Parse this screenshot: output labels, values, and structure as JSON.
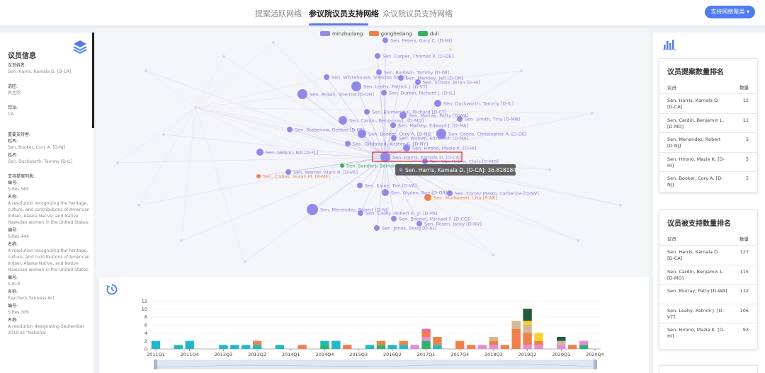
{
  "header": {
    "tabs": [
      {
        "label": "提案活跃网络"
      },
      {
        "label": "参议院议员支持网络"
      },
      {
        "label": "众议院议员支持网络"
      }
    ],
    "action_button": "支持网络聚类"
  },
  "left_panel": {
    "title": "议员信息",
    "name_label": "议员姓名:",
    "name_value": "Sen. Harris, Kamala D. [D-CA]",
    "district_label": "选区:",
    "district_value": "民主党",
    "party_label": "党派:",
    "party_value": "CA",
    "supporters_label": "重要支持者:",
    "supporters": [
      {
        "label": "姓名:",
        "value": "Sen. Booker, Cory A. [D-NJ]"
      },
      {
        "label": "姓名:",
        "value": "Sen. Duckworth, Tammy [D-IL]"
      }
    ],
    "bills_label": "支持提案列表:",
    "bills": [
      {
        "num_label": "编号:",
        "num": "S.Res.565",
        "name_label": "名称:",
        "name": "A resolution recognizing the heritage, culture, and contributions of American Indian, Alaska Native, and Native Hawaiian women in the United States."
      },
      {
        "num_label": "编号:",
        "num": "S.Res.444",
        "name_label": "名称:",
        "name": "A resolution recognizing the heritage, culture, and contributions of American Indian, Alaska Native, and Native Hawaiian women in the United States."
      },
      {
        "num_label": "编号:",
        "num": "S.819",
        "name_label": "名称:",
        "name": "Paycheck Fairness Act"
      },
      {
        "num_label": "编号:",
        "num": "S.Res.309",
        "name_label": "名称:",
        "name": "A resolution designating September 2019 as \"National"
      }
    ]
  },
  "network": {
    "legend": [
      {
        "label": "minzhudang",
        "color": "#8f8ae8"
      },
      {
        "label": "gonghedang",
        "color": "#f0804a"
      },
      {
        "label": "duli",
        "color": "#2fb36a"
      }
    ],
    "nodes": [
      {
        "label": "Sen. Peters, Gary C. [D-MI]",
        "party": "minzhudang"
      },
      {
        "label": "Sen. Carper, Thomas R. [D-DE]",
        "party": "minzhudang"
      },
      {
        "label": "Sen. Baldwin, Tammy [D-WI]",
        "party": "minzhudang"
      },
      {
        "label": "Sen. Whitehouse, Sheldon [D-RI]",
        "party": "minzhudang"
      },
      {
        "label": "Sen. Merkley, Jeff [D-OR]",
        "party": "minzhudang"
      },
      {
        "label": "Sen. Leahy, Patrick J. [D-VT]",
        "party": "minzhudang"
      },
      {
        "label": "Sen. Schatz, Brian [D-HI]",
        "party": "minzhudang"
      },
      {
        "label": "Sen. Brown, Sherrod [D-OH]",
        "party": "minzhudang"
      },
      {
        "label": "Sen. Durbin, Richard J. [D-IL]",
        "party": "minzhudang"
      },
      {
        "label": "Sen. Duckworth, Tammy [D-IL]",
        "party": "minzhudang"
      },
      {
        "label": "Sen. Blumenthal, Richard [D-CT]",
        "party": "minzhudang"
      },
      {
        "label": "Sen. Murray, Patty [D-WA]",
        "party": "minzhudang"
      },
      {
        "label": "Sen. Smith, Tina [D-MN]",
        "party": "minzhudang"
      },
      {
        "label": "Sen. Cardin, Benjamin L. [D-MD]",
        "party": "minzhudang"
      },
      {
        "label": "Sen. Markey, Edward J. [D-MA]",
        "party": "minzhudang"
      },
      {
        "label": "Sen. Stabenow, Debbie [D-MI]",
        "party": "minzhudang"
      },
      {
        "label": "Sen. Booker, Cory A. [D-NJ]",
        "party": "minzhudang"
      },
      {
        "label": "Sen. Coons, Christopher A. [D-DE]",
        "party": "minzhudang"
      },
      {
        "label": "Sen. Warren, Elizabeth [D-MA]",
        "party": "minzhudang"
      },
      {
        "label": "Sen. Gillibrand, Kirsten E. [D-NY]",
        "party": "minzhudang"
      },
      {
        "label": "Sen. Hirono, Mazie K. [D-HI]",
        "party": "minzhudang"
      },
      {
        "label": "Sen. Nelson, Bill [D-FL]",
        "party": "minzhudang"
      },
      {
        "label": "Sen. Harris, Kamala D. [D-CA]",
        "party": "minzhudang"
      },
      {
        "label": "Sen. Van Hollen, Chris [D-MD]",
        "party": "minzhudang"
      },
      {
        "label": "Sen. Sanders, Bernard [I-VT]",
        "party": "duli"
      },
      {
        "label": "Sen. Warner, Mark R. [D-VA]",
        "party": "minzhudang"
      },
      {
        "label": "Sen. Collins, Susan M. [R-ME]",
        "party": "gonghedang"
      },
      {
        "label": "Sen. Kaine, Tim [D-VA]",
        "party": "minzhudang"
      },
      {
        "label": "Sen. Wyden, Ron [D-OR]",
        "party": "minzhudang"
      },
      {
        "label": "Sen. Cortez Masto, Catherine [D-NV]",
        "party": "minzhudang"
      },
      {
        "label": "Sen. Murkowski, Lisa [R-AK]",
        "party": "gonghedang"
      },
      {
        "label": "Sen. Menendez, Robert [D-NJ]",
        "party": "minzhudang"
      },
      {
        "label": "Sen. Casey, Robert P., Jr. [D-PA]",
        "party": "minzhudang"
      },
      {
        "label": "Sen. Bennet, Michael F. [D-CO]",
        "party": "minzhudang"
      },
      {
        "label": "Sen. Rosen, Jacky [D-NV]",
        "party": "minzhudang"
      },
      {
        "label": "Sen. Jones, Doug [D-AL]",
        "party": "minzhudang"
      }
    ],
    "tooltip": "Sen. Harris, Kamala D. [D-CA]: 36.818184"
  },
  "chart_data": {
    "type": "bar",
    "stacked": true,
    "ylim": [
      0,
      12
    ],
    "yticks": [
      0,
      2,
      4,
      6,
      8,
      10,
      12
    ],
    "x_tick_labels": [
      "2011Q1",
      "2011Q4",
      "2012Q3",
      "2013Q2",
      "2014Q1",
      "2014Q4",
      "2015Q3",
      "2016Q2",
      "2017Q1",
      "2017Q4",
      "2018Q3",
      "2019Q2",
      "2020Q1",
      "2020Q4"
    ],
    "categories": [
      "2011Q1",
      "2011Q2",
      "2011Q3",
      "2011Q4",
      "2012Q1",
      "2012Q2",
      "2012Q3",
      "2012Q4",
      "2013Q1",
      "2013Q2",
      "2013Q3",
      "2013Q4",
      "2014Q1",
      "2014Q2",
      "2014Q3",
      "2014Q4",
      "2015Q1",
      "2015Q2",
      "2015Q3",
      "2015Q4",
      "2016Q1",
      "2016Q2",
      "2016Q3",
      "2016Q4",
      "2017Q1",
      "2017Q2",
      "2017Q3",
      "2017Q4",
      "2018Q1",
      "2018Q2",
      "2018Q3",
      "2018Q4",
      "2019Q1",
      "2019Q2",
      "2019Q3",
      "2019Q4",
      "2020Q1",
      "2020Q2",
      "2020Q3",
      "2020Q4"
    ],
    "series": [
      {
        "color": "#2fb36a",
        "values": [
          0,
          0,
          0,
          0,
          0,
          0,
          0,
          0,
          0,
          0,
          0,
          0,
          0,
          0,
          0,
          1,
          0,
          0,
          0,
          0,
          1,
          0,
          0,
          0,
          2,
          0,
          0,
          0,
          0,
          0,
          0,
          0,
          0,
          0,
          0,
          0,
          0,
          0,
          1,
          0
        ]
      },
      {
        "color": "#1fb9c9",
        "values": [
          2,
          0,
          1,
          2,
          0,
          0,
          1,
          1,
          1,
          1,
          0,
          1,
          0,
          0,
          0,
          1,
          2,
          0,
          0,
          1,
          0,
          1,
          1,
          0,
          0,
          1,
          0,
          0,
          0,
          0,
          0,
          0,
          0,
          0,
          0,
          0,
          0,
          0,
          0,
          0
        ]
      },
      {
        "color": "#e88ad8",
        "values": [
          0,
          0,
          0,
          0,
          0,
          0,
          0,
          0,
          0,
          0,
          0,
          0,
          0,
          0,
          0,
          0,
          0,
          0,
          0,
          0,
          0,
          0,
          0,
          1,
          1,
          0,
          0,
          0,
          0,
          1,
          1,
          0,
          0,
          1,
          1,
          0,
          1,
          0,
          1,
          0
        ]
      },
      {
        "color": "#f0804a",
        "values": [
          0,
          0,
          0,
          0,
          0,
          0,
          0,
          0,
          0,
          1,
          0,
          0,
          0,
          1,
          0,
          0,
          0,
          1,
          0,
          0,
          1,
          0,
          1,
          0,
          1,
          2,
          0,
          2,
          1,
          0,
          1,
          1,
          5,
          3,
          1,
          0,
          0,
          1,
          0,
          0
        ]
      },
      {
        "color": "#d4b896",
        "values": [
          0,
          0,
          0,
          0,
          0,
          0,
          0,
          0,
          0,
          0,
          0,
          0,
          0,
          0,
          0,
          0,
          0,
          0,
          0,
          0,
          0,
          0,
          0,
          0,
          0,
          0,
          0,
          0,
          0,
          0,
          1,
          0,
          2,
          2,
          0,
          0,
          1,
          0,
          0,
          0
        ]
      },
      {
        "color": "#f6d22e",
        "values": [
          0,
          0,
          0,
          0,
          0,
          0,
          0,
          0,
          0,
          0,
          0,
          0,
          0,
          0,
          0,
          0,
          0,
          0,
          0,
          0,
          0,
          0,
          0,
          0,
          0,
          0,
          0,
          0,
          0,
          0,
          0,
          0,
          0,
          1,
          2,
          0,
          0,
          0,
          0,
          0
        ]
      },
      {
        "color": "#ee6a8e",
        "values": [
          0,
          0,
          0,
          0,
          0,
          0,
          0,
          0,
          0,
          0,
          0,
          0,
          0,
          0,
          0,
          0,
          0,
          0,
          0,
          0,
          0,
          0,
          0,
          0,
          1,
          0,
          0,
          0,
          0,
          0,
          0,
          0,
          0,
          0,
          0,
          0,
          0,
          0,
          0,
          0
        ]
      },
      {
        "color": "#1f5a3e",
        "values": [
          0,
          0,
          0,
          0,
          0,
          0,
          0,
          0,
          0,
          0,
          0,
          0,
          0,
          0,
          0,
          0,
          0,
          0,
          0,
          0,
          0,
          0,
          0,
          0,
          0,
          0,
          0,
          0,
          0,
          0,
          0,
          0,
          0,
          3,
          0,
          0,
          1,
          0,
          0,
          0
        ]
      }
    ]
  },
  "right_panel": {
    "card1": {
      "title": "议员提案数量排名",
      "col_name": "议员",
      "col_count": "数量",
      "rows": [
        {
          "name": "Sen. Harris, Kamala D. [D-CA]",
          "count": "12"
        },
        {
          "name": "Sen. Cardin, Benjamin L. [D-MD]",
          "count": "11"
        },
        {
          "name": "Sen. Menendez, Robert [D-NJ]",
          "count": "5"
        },
        {
          "name": "Sen. Hirono, Mazie K. [D-HI]",
          "count": "5"
        },
        {
          "name": "Sen. Booker, Cory A. [D-NJ]",
          "count": "5"
        }
      ]
    },
    "card2": {
      "title": "议员被支持数量排名",
      "col_name": "议员",
      "col_count": "数量",
      "rows": [
        {
          "name": "Sen. Harris, Kamala D. [D-CA]",
          "count": "127"
        },
        {
          "name": "Sen. Cardin, Benjamin L. [D-MD]",
          "count": "115"
        },
        {
          "name": "Sen. Murray, Patty [D-WA]",
          "count": "112"
        },
        {
          "name": "Sen. Leahy, Patrick J. [D-VT]",
          "count": "106"
        },
        {
          "name": "Sen. Hirono, Mazie K. [D-HI]",
          "count": "93"
        }
      ]
    }
  }
}
